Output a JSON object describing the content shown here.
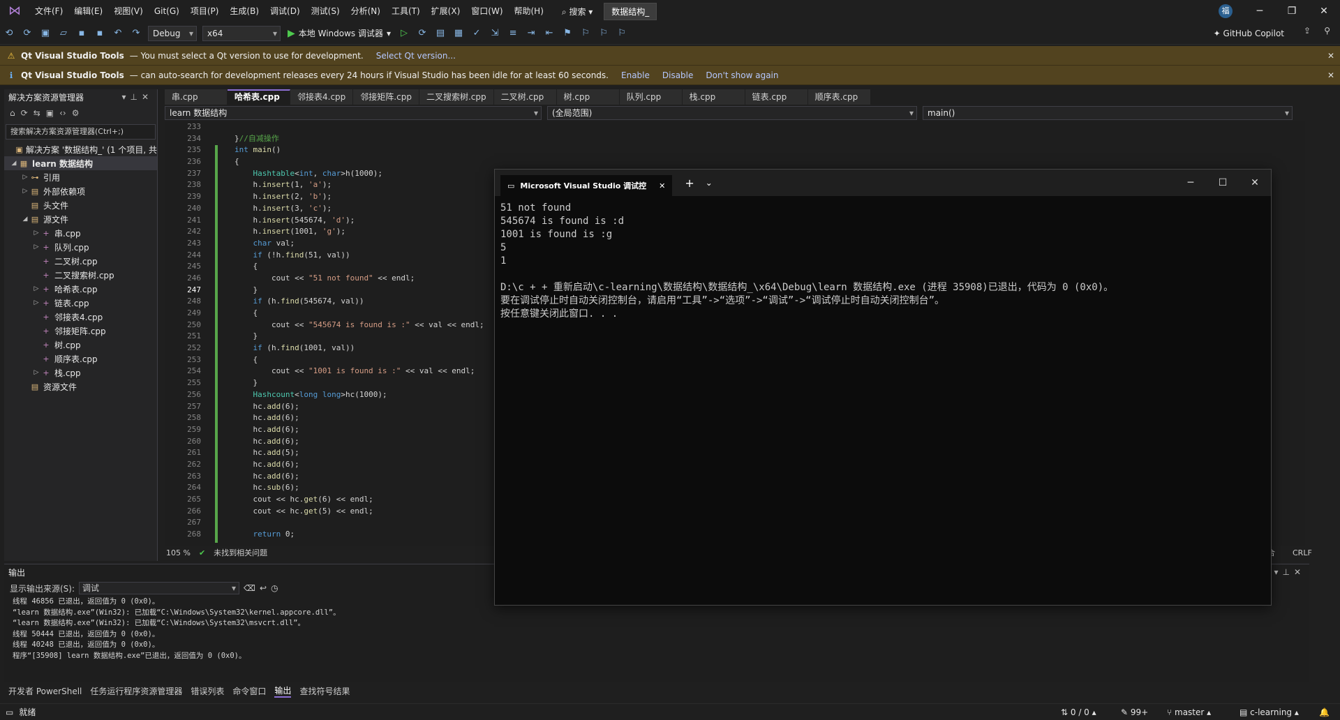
{
  "menubar": {
    "items": [
      "文件(F)",
      "编辑(E)",
      "视图(V)",
      "Git(G)",
      "项目(P)",
      "生成(B)",
      "调试(D)",
      "测试(S)",
      "分析(N)",
      "工具(T)",
      "扩展(X)",
      "窗口(W)",
      "帮助(H)"
    ],
    "search": "搜索",
    "project": "数据结构_",
    "avatar": "福"
  },
  "toolbar": {
    "config": "Debug",
    "platform": "x64",
    "run_label": "本地 Windows 调试器",
    "copilot": "GitHub Copilot"
  },
  "infobars": [
    {
      "title": "Qt Visual Studio Tools",
      "message": "— You must select a Qt version to use for development.",
      "links": [
        "Select Qt version..."
      ]
    },
    {
      "title": "Qt Visual Studio Tools",
      "message": "— can auto-search for development releases every 24 hours if Visual Studio has been idle for at least 60 seconds.",
      "links": [
        "Enable",
        "Disable",
        "Don't show again"
      ]
    }
  ],
  "solution_explorer": {
    "title": "解决方案资源管理器",
    "search_placeholder": "搜索解决方案资源管理器(Ctrl+;)",
    "rows": [
      {
        "label": "解决方案 '数据结构_' (1 个项目, 共",
        "level": 0,
        "tw": "",
        "icon": "▣"
      },
      {
        "label": "learn 数据结构",
        "level": 0,
        "tw": "◢",
        "icon": "▦",
        "bold": true
      },
      {
        "label": "引用",
        "level": 1,
        "tw": "▷",
        "icon": "⊶"
      },
      {
        "label": "外部依赖项",
        "level": 1,
        "tw": "▷",
        "icon": "▤"
      },
      {
        "label": "头文件",
        "level": 1,
        "tw": "",
        "icon": "▤"
      },
      {
        "label": "源文件",
        "level": 1,
        "tw": "◢",
        "icon": "▤"
      },
      {
        "label": "串.cpp",
        "level": 2,
        "tw": "▷",
        "icon": "+"
      },
      {
        "label": "队列.cpp",
        "level": 2,
        "tw": "▷",
        "icon": "+"
      },
      {
        "label": "二叉树.cpp",
        "level": 2,
        "tw": "",
        "icon": "+"
      },
      {
        "label": "二叉搜索树.cpp",
        "level": 2,
        "tw": "",
        "icon": "+"
      },
      {
        "label": "哈希表.cpp",
        "level": 2,
        "tw": "▷",
        "icon": "+"
      },
      {
        "label": "链表.cpp",
        "level": 2,
        "tw": "▷",
        "icon": "+"
      },
      {
        "label": "邻接表4.cpp",
        "level": 2,
        "tw": "",
        "icon": "+"
      },
      {
        "label": "邻接矩阵.cpp",
        "level": 2,
        "tw": "",
        "icon": "+"
      },
      {
        "label": "树.cpp",
        "level": 2,
        "tw": "",
        "icon": "+"
      },
      {
        "label": "顺序表.cpp",
        "level": 2,
        "tw": "",
        "icon": "+"
      },
      {
        "label": "栈.cpp",
        "level": 2,
        "tw": "▷",
        "icon": "+"
      },
      {
        "label": "资源文件",
        "level": 1,
        "tw": "",
        "icon": "▤"
      }
    ]
  },
  "tabs": [
    "串.cpp",
    "哈希表.cpp",
    "邻接表4.cpp",
    "邻接矩阵.cpp",
    "二叉搜索树.cpp",
    "二叉树.cpp",
    "树.cpp",
    "队列.cpp",
    "栈.cpp",
    "链表.cpp",
    "顺序表.cpp"
  ],
  "active_tab": 1,
  "navbar": {
    "project": "learn 数据结构",
    "scope": "(全局范围)",
    "member": "main()"
  },
  "editor": {
    "lines": [
      {
        "n": "233",
        "html": ""
      },
      {
        "n": "234",
        "html": "<span class='tx'>}</span><span class='cm'>//自减操作</span>"
      },
      {
        "n": "235",
        "html": "<span class='kw'>int</span> <span class='fn'>main</span><span class='tx'>()</span>"
      },
      {
        "n": "236",
        "html": "<span class='tx'>{</span>"
      },
      {
        "n": "237",
        "html": "    <span class='ty'>Hashtable</span><span class='tx'>&lt;</span><span class='kw'>int</span><span class='tx'>, </span><span class='kw'>char</span><span class='tx'>&gt;h(1000);</span>"
      },
      {
        "n": "238",
        "html": "    <span class='tx'>h.</span><span class='fn'>insert</span><span class='tx'>(1, </span><span class='st'>'a'</span><span class='tx'>);</span>"
      },
      {
        "n": "239",
        "html": "    <span class='tx'>h.</span><span class='fn'>insert</span><span class='tx'>(2, </span><span class='st'>'b'</span><span class='tx'>);</span>"
      },
      {
        "n": "240",
        "html": "    <span class='tx'>h.</span><span class='fn'>insert</span><span class='tx'>(3, </span><span class='st'>'c'</span><span class='tx'>);</span>"
      },
      {
        "n": "241",
        "html": "    <span class='tx'>h.</span><span class='fn'>insert</span><span class='tx'>(545674, </span><span class='st'>'d'</span><span class='tx'>);</span>"
      },
      {
        "n": "242",
        "html": "    <span class='tx'>h.</span><span class='fn'>insert</span><span class='tx'>(1001, </span><span class='st'>'g'</span><span class='tx'>);</span>"
      },
      {
        "n": "243",
        "html": "    <span class='kw'>char</span> <span class='tx'>val;</span>"
      },
      {
        "n": "244",
        "html": "    <span class='kw'>if</span> <span class='tx'>(!h.</span><span class='fn'>find</span><span class='tx'>(51, val))</span>"
      },
      {
        "n": "245",
        "html": "    <span class='tx'>{</span>"
      },
      {
        "n": "246",
        "html": "        <span class='tx'>cout &lt;&lt; </span><span class='st'>\"51 not found\"</span><span class='tx'> &lt;&lt; endl;</span>"
      },
      {
        "n": "247",
        "html": "    <span class='tx'>}</span>"
      },
      {
        "n": "248",
        "html": "    <span class='kw'>if</span> <span class='tx'>(h.</span><span class='fn'>find</span><span class='tx'>(545674, val))</span>"
      },
      {
        "n": "249",
        "html": "    <span class='tx'>{</span>"
      },
      {
        "n": "250",
        "html": "        <span class='tx'>cout &lt;&lt; </span><span class='st'>\"545674 is found is :\"</span><span class='tx'> &lt;&lt; val &lt;&lt; endl;</span>"
      },
      {
        "n": "251",
        "html": "    <span class='tx'>}</span>"
      },
      {
        "n": "252",
        "html": "    <span class='kw'>if</span> <span class='tx'>(h.</span><span class='fn'>find</span><span class='tx'>(1001, val))</span>"
      },
      {
        "n": "253",
        "html": "    <span class='tx'>{</span>"
      },
      {
        "n": "254",
        "html": "        <span class='tx'>cout &lt;&lt; </span><span class='st'>\"1001 is found is :\"</span><span class='tx'> &lt;&lt; val &lt;&lt; endl;</span>"
      },
      {
        "n": "255",
        "html": "    <span class='tx'>}</span>"
      },
      {
        "n": "256",
        "html": "    <span class='ty'>Hashcount</span><span class='tx'>&lt;</span><span class='kw'>long long</span><span class='tx'>&gt;hc(1000);</span>"
      },
      {
        "n": "257",
        "html": "    <span class='tx'>hc.</span><span class='fn'>add</span><span class='tx'>(6);</span>"
      },
      {
        "n": "258",
        "html": "    <span class='tx'>hc.</span><span class='fn'>add</span><span class='tx'>(6);</span>"
      },
      {
        "n": "259",
        "html": "    <span class='tx'>hc.</span><span class='fn'>add</span><span class='tx'>(6);</span>"
      },
      {
        "n": "260",
        "html": "    <span class='tx'>hc.</span><span class='fn'>add</span><span class='tx'>(6);</span>"
      },
      {
        "n": "261",
        "html": "    <span class='tx'>hc.</span><span class='fn'>add</span><span class='tx'>(5);</span>"
      },
      {
        "n": "262",
        "html": "    <span class='tx'>hc.</span><span class='fn'>add</span><span class='tx'>(6);</span>"
      },
      {
        "n": "263",
        "html": "    <span class='tx'>hc.</span><span class='fn'>add</span><span class='tx'>(6);</span>"
      },
      {
        "n": "264",
        "html": "    <span class='tx'>hc.</span><span class='fn'>sub</span><span class='tx'>(6);</span>"
      },
      {
        "n": "265",
        "html": "    <span class='tx'>cout &lt;&lt; hc.</span><span class='fn'>get</span><span class='tx'>(6) &lt;&lt; endl;</span>"
      },
      {
        "n": "266",
        "html": "    <span class='tx'>cout &lt;&lt; hc.</span><span class='fn'>get</span><span class='tx'>(5) &lt;&lt; endl;</span>"
      },
      {
        "n": "267",
        "html": ""
      },
      {
        "n": "268",
        "html": "    <span class='kw'>return</span> <span class='tx'>0;</span>"
      }
    ],
    "current_line": "247"
  },
  "editor_status": {
    "zoom": "105 %",
    "issues": "未找到相关问题",
    "eol": "CRLF",
    "encoding_fragment": "合"
  },
  "console": {
    "title": "Microsoft Visual Studio 调试控",
    "lines": [
      "51 not found",
      "545674 is found is :d",
      "1001 is found is :g",
      "5",
      "1",
      "",
      "D:\\c + + 重新启动\\c-learning\\数据结构\\数据结构_\\x64\\Debug\\learn 数据结构.exe (进程 35908)已退出，代码为 0 (0x0)。",
      "要在调试停止时自动关闭控制台，请启用“工具”->“选项”->“调试”->“调试停止时自动关闭控制台”。",
      "按任意键关闭此窗口. . ."
    ]
  },
  "output": {
    "title": "输出",
    "source_label": "显示输出来源(S):",
    "source_value": "调试",
    "lines": [
      "线程 46856 已退出，返回值为 0 (0x0)。",
      "“learn 数据结构.exe”(Win32): 已加载“C:\\Windows\\System32\\kernel.appcore.dll”。",
      "“learn 数据结构.exe”(Win32): 已加载“C:\\Windows\\System32\\msvcrt.dll”。",
      "线程 50444 已退出，返回值为 0 (0x0)。",
      "线程 40248 已退出，返回值为 0 (0x0)。",
      "程序“[35908] learn 数据结构.exe”已退出，返回值为 0 (0x0)。"
    ]
  },
  "bottom_tabs": [
    "开发者 PowerShell",
    "任务运行程序资源管理器",
    "错误列表",
    "命令窗口",
    "输出",
    "查找符号结果"
  ],
  "bottom_active": 4,
  "statusbar": {
    "ready": "就绪",
    "lines": "0 / 0",
    "pencil": "99+",
    "branch": "master",
    "repo": "c-learning"
  }
}
